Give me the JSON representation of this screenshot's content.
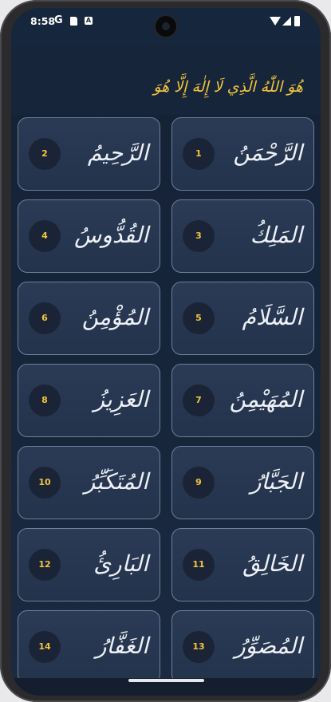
{
  "status_bar": {
    "time": "8:58",
    "google_icon": "G",
    "a_icon": "A"
  },
  "header": {
    "title": "هُوَ اللّٰهُ الَّذِي لَا إِلٰهَ إِلَّا هُوَ"
  },
  "names": [
    {
      "number": "1",
      "arabic": "الرَّحْمَنُ"
    },
    {
      "number": "2",
      "arabic": "الرَّحِيمُ"
    },
    {
      "number": "3",
      "arabic": "المَلِكُ"
    },
    {
      "number": "4",
      "arabic": "القُدُّوسُ"
    },
    {
      "number": "5",
      "arabic": "السَّلَامُ"
    },
    {
      "number": "6",
      "arabic": "المُؤْمِنُ"
    },
    {
      "number": "7",
      "arabic": "المُهَيْمِنُ"
    },
    {
      "number": "8",
      "arabic": "العَزِيزُ"
    },
    {
      "number": "9",
      "arabic": "الجَبَّارُ"
    },
    {
      "number": "10",
      "arabic": "المُتَكَبِّرُ"
    },
    {
      "number": "11",
      "arabic": "الخَالِقُ"
    },
    {
      "number": "12",
      "arabic": "البَارِئُ"
    },
    {
      "number": "13",
      "arabic": "المُصَوِّرُ"
    },
    {
      "number": "14",
      "arabic": "الغَفَّارُ"
    }
  ],
  "colors": {
    "accent": "#f2c53d",
    "background": "#16243a",
    "card": "#2b3a55",
    "card_border": "#6f7f98"
  }
}
